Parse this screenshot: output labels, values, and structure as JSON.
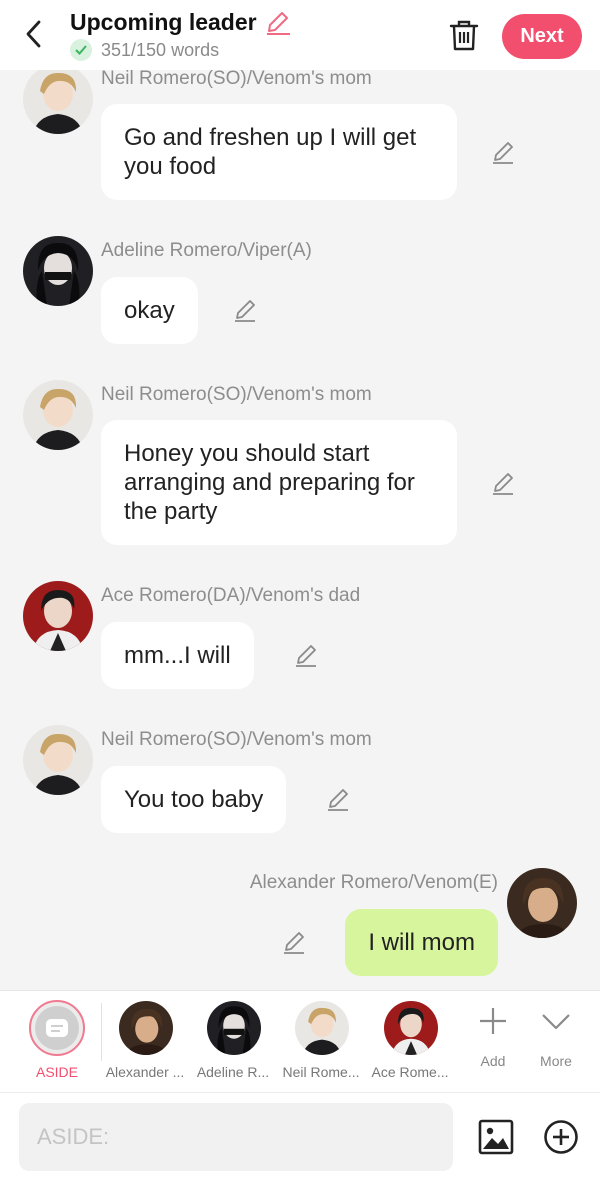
{
  "header": {
    "title": "Upcoming leader",
    "word_count": "351/150 words",
    "next_label": "Next",
    "accent": "#f24f6f"
  },
  "messages": [
    {
      "speaker": "Neil Romero(SO)/Venom's mom",
      "text": "Go and freshen up I will get you food",
      "side": "left"
    },
    {
      "speaker": "Adeline Romero/Viper(A)",
      "text": "okay",
      "side": "left"
    },
    {
      "speaker": "Neil Romero(SO)/Venom's mom",
      "text": "Honey you should start arranging and preparing for the party",
      "side": "left"
    },
    {
      "speaker": "Ace Romero(DA)/Venom's dad",
      "text": "mm...I will",
      "side": "left"
    },
    {
      "speaker": "Neil Romero(SO)/Venom's mom",
      "text": "You too baby",
      "side": "left"
    },
    {
      "speaker": "Alexander Romero/Venom(E)",
      "text": "I will mom",
      "side": "right"
    }
  ],
  "characters": [
    {
      "label": "ASIDE"
    },
    {
      "label": "Alexander ..."
    },
    {
      "label": "Adeline R..."
    },
    {
      "label": "Neil Rome..."
    },
    {
      "label": "Ace Rome..."
    }
  ],
  "tools": {
    "add_label": "Add",
    "more_label": "More"
  },
  "input": {
    "placeholder": "ASIDE:"
  },
  "icons": [
    "back-arrow-icon",
    "pencil-icon",
    "check-icon",
    "trash-icon",
    "image-icon",
    "plus-circle-icon",
    "plus-icon",
    "chevron-down-icon"
  ]
}
